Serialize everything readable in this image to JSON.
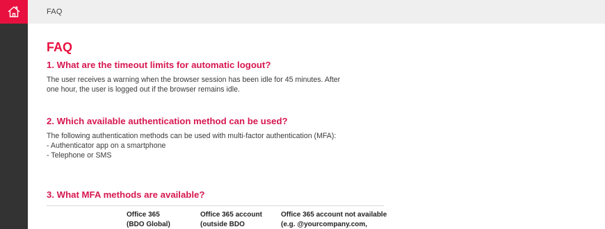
{
  "topbar": {
    "breadcrumb": "FAQ"
  },
  "sidebar": {
    "home_icon": "home-icon",
    "accent": "#e8103f"
  },
  "page": {
    "title": "FAQ"
  },
  "faq": [
    {
      "question": "1. What are the timeout limits for automatic logout?",
      "lines": [
        "The user receives a warning when the browser session has been idle for 45 minutes. After",
        "one hour, the user is logged out if the browser remains idle."
      ]
    },
    {
      "question": "2. Which available authentication method can be used?",
      "lines": [
        "The following authentication methods can be used with multi-factor authentication (MFA):",
        "- Authenticator app on a smartphone",
        "- Telephone or SMS"
      ]
    },
    {
      "question": "3. What MFA methods are available?",
      "table_headers": [
        {
          "line1": "Office 365",
          "line2": "(BDO Global)"
        },
        {
          "line1": "Office 365 account",
          "line2": "(outside BDO"
        },
        {
          "line1": "Office 365 account not available",
          "line2": "(e.g. @yourcompany.com,"
        }
      ]
    }
  ]
}
